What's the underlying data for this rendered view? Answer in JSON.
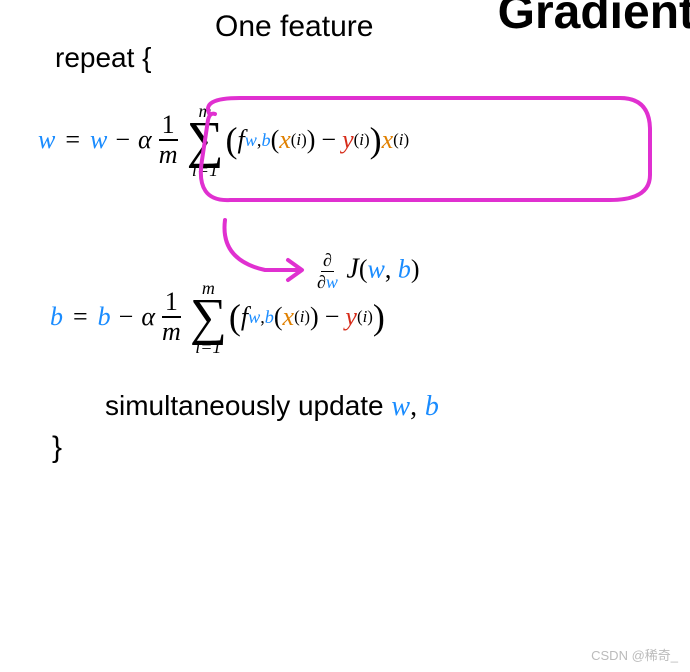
{
  "heading": "One feature",
  "repeat_text": "repeat {",
  "w_var": "w",
  "b_var": "b",
  "equals": "=",
  "minus": "−",
  "alpha": "α",
  "frac_num": "1",
  "frac_den": "m",
  "sum_top": "m",
  "sum_bot": "i=1",
  "sigma": "∑",
  "lparen": "(",
  "rparen": ")",
  "f_sym": "f",
  "sub_wb_w": "w",
  "sub_wb_comma": ",",
  "sub_wb_b": "b",
  "x_sym": "x",
  "y_sym": "y",
  "sup_i_open": "(",
  "sup_i_i": "i",
  "sup_i_close": ")",
  "partial": "∂",
  "J_sym": "J",
  "comma": ",",
  "update_text": "simultaneously update",
  "close_brace": "}",
  "watermark": "CSDN @稀奇_",
  "top_crop": "Gradient",
  "chart_data": null
}
